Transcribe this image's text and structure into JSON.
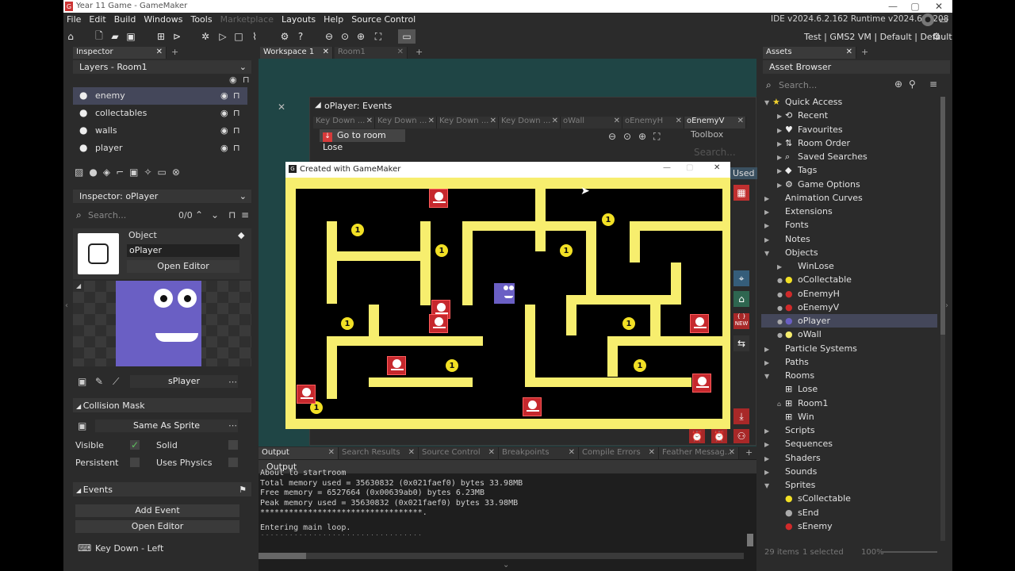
{
  "app": {
    "title": "Year 11 Game - GameMaker",
    "ide_version": "IDE v2024.6.2.162  Runtime v2024.6.1.208",
    "target": "Test | GMS2 VM | Default | Default"
  },
  "menu": [
    "File",
    "Edit",
    "Build",
    "Windows",
    "Tools",
    "Marketplace",
    "Layouts",
    "Help",
    "Source Control"
  ],
  "inspector": {
    "tab": "Inspector",
    "layers_title": "Layers - Room1",
    "layers": [
      "enemy",
      "collectables",
      "walls",
      "player"
    ],
    "obj_header": "Inspector: oPlayer",
    "search_placeholder": "Search...",
    "search_count": "0/0",
    "object_label": "Object",
    "object_name": "oPlayer",
    "open_editor": "Open Editor",
    "sprite_name": "sPlayer",
    "collision_mask_title": "Collision Mask",
    "collision_mask_value": "Same As Sprite",
    "visible": "Visible",
    "solid": "Solid",
    "persistent": "Persistent",
    "uses_physics": "Uses Physics",
    "events_title": "Events",
    "add_event": "Add Event",
    "open_editor2": "Open Editor",
    "event_item": "Key Down - Left"
  },
  "workspace": {
    "tabs": [
      "Workspace 1",
      "Room1"
    ],
    "events_title": "oPlayer: Events",
    "event_tabs": [
      "Key Down ...",
      "Key Down ...",
      "Key Down ...",
      "Key Down ...",
      "oWall",
      "oEnemyH",
      "oEnemyV"
    ],
    "action": "Go to room Lose",
    "toolbox": "Toolbox",
    "toolbox_search": "Search...",
    "badge_new": "NEW",
    "used": "Used"
  },
  "game_window": {
    "title": "Created with GameMaker",
    "coin_label": "1"
  },
  "output": {
    "tabs": [
      "Output",
      "Search Results",
      "Source Control",
      "Breakpoints",
      "Compile Errors",
      "Feather Messag..."
    ],
    "title": "Output",
    "lines": [
      "About to startroom",
      "Total memory used = 35630832 (0x021faef0) bytes 33.98MB",
      "Free memory = 6527664 (0x00639ab0) bytes 6.23MB",
      "Peak memory used = 35630832 (0x021faef0) bytes 33.98MB",
      "**********************************.",
      "Entering main loop.",
      "**********************************."
    ]
  },
  "assets": {
    "tab": "Assets",
    "browser_title": "Asset Browser",
    "search_placeholder": "Search...",
    "quick_access": "Quick Access",
    "quick_items": [
      "Recent",
      "Favourites",
      "Room Order",
      "Saved Searches",
      "Tags",
      "Game Options"
    ],
    "groups_a": [
      "Animation Curves",
      "Extensions",
      "Fonts",
      "Notes"
    ],
    "objects": "Objects",
    "object_items": [
      "WinLose",
      "oCollectable",
      "oEnemyH",
      "oEnemyV",
      "oPlayer",
      "oWall"
    ],
    "groups_b": [
      "Particle Systems",
      "Paths"
    ],
    "rooms": "Rooms",
    "room_items": [
      "Lose",
      "Room1",
      "Win"
    ],
    "groups_c": [
      "Scripts",
      "Sequences",
      "Shaders",
      "Sounds"
    ],
    "sprites": "Sprites",
    "sprite_items": [
      "sCollectable",
      "sEnd",
      "sEnemy"
    ],
    "status_count": "29 items",
    "status_selected": "1 selected",
    "status_zoom": "100%"
  },
  "colors": {
    "wall": "#f7ee6e",
    "enemy": "#c6282d",
    "player": "#6a5fc4",
    "selection": "#44475a"
  }
}
